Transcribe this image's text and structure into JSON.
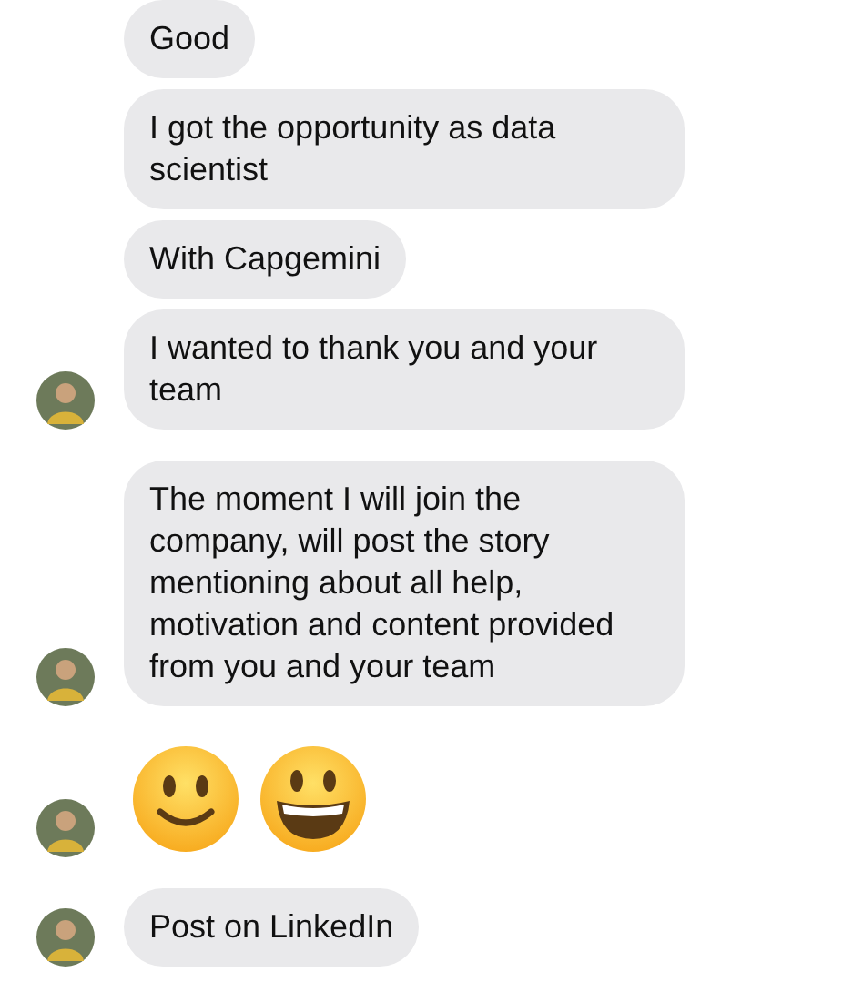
{
  "messages": [
    {
      "kind": "text",
      "text": "Good",
      "avatar": false
    },
    {
      "kind": "text",
      "text": "I got the opportunity as data scientist",
      "avatar": false
    },
    {
      "kind": "text",
      "text": "With Capgemini",
      "avatar": false
    },
    {
      "kind": "text",
      "text": "I wanted to thank you and your team",
      "avatar": true
    },
    {
      "kind": "text",
      "text": "The moment I will join the company, will post the story mentioning about all help, motivation and content provided from you and your team",
      "avatar": true
    },
    {
      "kind": "emoji",
      "faces": [
        {
          "kind": "smile"
        },
        {
          "kind": "grin"
        }
      ],
      "avatar": true
    },
    {
      "kind": "text",
      "text": "Post on LinkedIn",
      "avatar": true
    }
  ]
}
